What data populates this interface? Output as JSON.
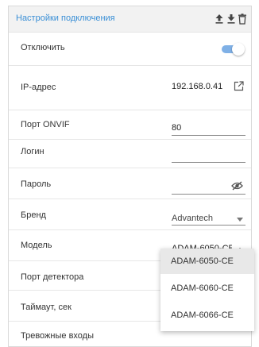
{
  "header": {
    "title": "Настройки подключения",
    "icons": [
      "upload-icon",
      "download-icon",
      "trash-icon"
    ]
  },
  "rows": {
    "disable": {
      "label": "Отключить",
      "toggle_on": true
    },
    "ip": {
      "label": "IP-адрес",
      "value": "192.168.0.41"
    },
    "onvif": {
      "label": "Порт ONVIF",
      "value": "80"
    },
    "login": {
      "label": "Логин",
      "value": ""
    },
    "password": {
      "label": "Пароль",
      "value": ""
    },
    "brand": {
      "label": "Бренд",
      "value": "Advantech"
    },
    "model": {
      "label": "Модель",
      "value": "ADAM-6050-CE"
    },
    "detector_port": {
      "label": "Порт детектора"
    },
    "timeout": {
      "label": "Таймаут, сек"
    },
    "alarm_inputs": {
      "label": "Тревожные входы"
    }
  },
  "model_options": [
    "ADAM-6050-CE",
    "ADAM-6060-CE",
    "ADAM-6066-CE"
  ],
  "colors": {
    "accent": "#3a8fd6",
    "toggle_track": "#7fb0e6"
  }
}
